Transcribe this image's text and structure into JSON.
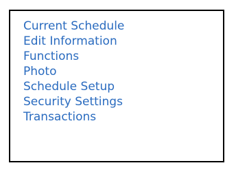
{
  "menu": {
    "link_color": "#2a6bbf",
    "border_color": "#000000",
    "items": [
      {
        "label": "Current Schedule"
      },
      {
        "label": "Edit Information"
      },
      {
        "label": "Functions"
      },
      {
        "label": "Photo"
      },
      {
        "label": "Schedule Setup"
      },
      {
        "label": "Security Settings"
      },
      {
        "label": "Transactions"
      }
    ]
  }
}
